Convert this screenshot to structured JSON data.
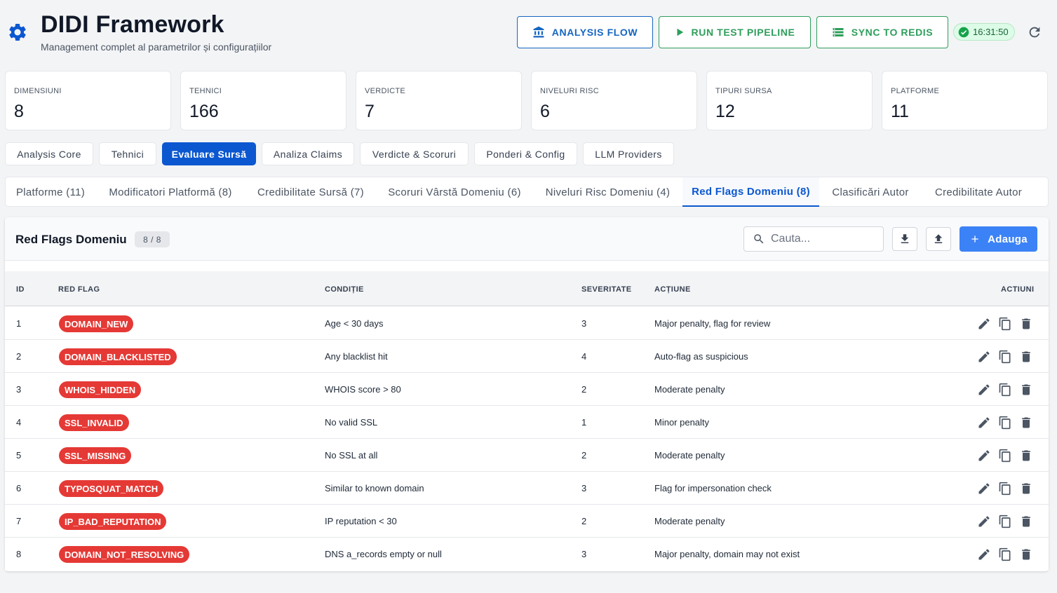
{
  "header": {
    "title": "DIDI Framework",
    "subtitle": "Management complet al parametrilor și configurațiilor",
    "buttons": {
      "analysis_flow": "ANALYSIS FLOW",
      "run_pipeline": "RUN TEST PIPELINE",
      "sync_redis": "SYNC TO REDIS"
    },
    "time": "16:31:50"
  },
  "stats": [
    {
      "label": "DIMENSIUNI",
      "value": "8"
    },
    {
      "label": "TEHNICI",
      "value": "166"
    },
    {
      "label": "VERDICTE",
      "value": "7"
    },
    {
      "label": "NIVELURI RISC",
      "value": "6"
    },
    {
      "label": "TIPURI SURSA",
      "value": "12"
    },
    {
      "label": "PLATFORME",
      "value": "11"
    }
  ],
  "primary_tabs": [
    {
      "label": "Analysis Core"
    },
    {
      "label": "Tehnici"
    },
    {
      "label": "Evaluare Sursă",
      "active": true
    },
    {
      "label": "Analiza Claims"
    },
    {
      "label": "Verdicte & Scoruri"
    },
    {
      "label": "Ponderi & Config"
    },
    {
      "label": "LLM Providers"
    }
  ],
  "secondary_tabs": [
    {
      "label": "Platforme (11)"
    },
    {
      "label": "Modificatori Platformă (8)"
    },
    {
      "label": "Credibilitate Sursă (7)"
    },
    {
      "label": "Scoruri Vârstă Domeniu (6)"
    },
    {
      "label": "Niveluri Risc Domeniu (4)"
    },
    {
      "label": "Red Flags Domeniu (8)",
      "active": true
    },
    {
      "label": "Clasificări Autor"
    },
    {
      "label": "Credibilitate Autor"
    }
  ],
  "panel": {
    "title": "Red Flags Domeniu",
    "count": "8 / 8",
    "search_placeholder": "Cauta...",
    "add_label": "Adauga"
  },
  "table": {
    "columns": {
      "id": "ID",
      "flag": "RED FLAG",
      "condition": "CONDIȚIE",
      "severity": "SEVERITATE",
      "action": "ACȚIUNE",
      "actions": "ACTIUNI"
    },
    "rows": [
      {
        "id": "1",
        "flag": "DOMAIN_NEW",
        "condition": "Age < 30 days",
        "severity": "3",
        "action": "Major penalty, flag for review"
      },
      {
        "id": "2",
        "flag": "DOMAIN_BLACKLISTED",
        "condition": "Any blacklist hit",
        "severity": "4",
        "action": "Auto-flag as suspicious"
      },
      {
        "id": "3",
        "flag": "WHOIS_HIDDEN",
        "condition": "WHOIS score > 80",
        "severity": "2",
        "action": "Moderate penalty"
      },
      {
        "id": "4",
        "flag": "SSL_INVALID",
        "condition": "No valid SSL",
        "severity": "1",
        "action": "Minor penalty"
      },
      {
        "id": "5",
        "flag": "SSL_MISSING",
        "condition": "No SSL at all",
        "severity": "2",
        "action": "Moderate penalty"
      },
      {
        "id": "6",
        "flag": "TYPOSQUAT_MATCH",
        "condition": "Similar to known domain",
        "severity": "3",
        "action": "Flag for impersonation check"
      },
      {
        "id": "7",
        "flag": "IP_BAD_REPUTATION",
        "condition": "IP reputation < 30",
        "severity": "2",
        "action": "Moderate penalty"
      },
      {
        "id": "8",
        "flag": "DOMAIN_NOT_RESOLVING",
        "condition": "DNS a_records empty or null",
        "severity": "3",
        "action": "Major penalty, domain may not exist"
      }
    ]
  },
  "colors": {
    "primary": "#0b57d0",
    "success": "#2e9e5b",
    "danger": "#e53935",
    "add_button": "#3b82f6"
  }
}
